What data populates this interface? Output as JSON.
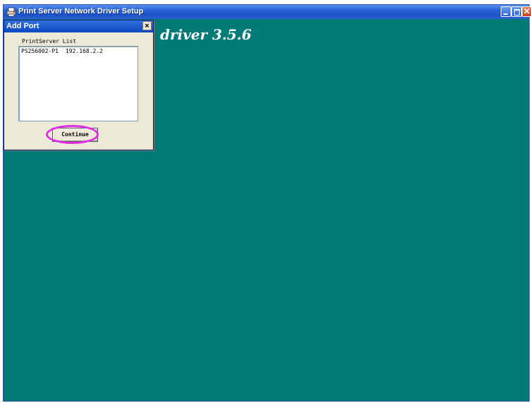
{
  "main_window": {
    "title": "Print Server Network Driver Setup",
    "banner_text": "driver 3.5.6",
    "background_color": "#027b77",
    "controls": {
      "minimize_icon": "minimize-icon",
      "maximize_icon": "maximize-icon",
      "close_glyph": "✕"
    }
  },
  "dialog": {
    "title": "Add Port",
    "close_glyph": "×",
    "list_label": "PrintServer List",
    "list_items": [
      {
        "name": "PS256002-P1",
        "ip": "192.168.2.2"
      }
    ],
    "continue_label": "Continue",
    "highlight_color": "#e22ce6"
  }
}
